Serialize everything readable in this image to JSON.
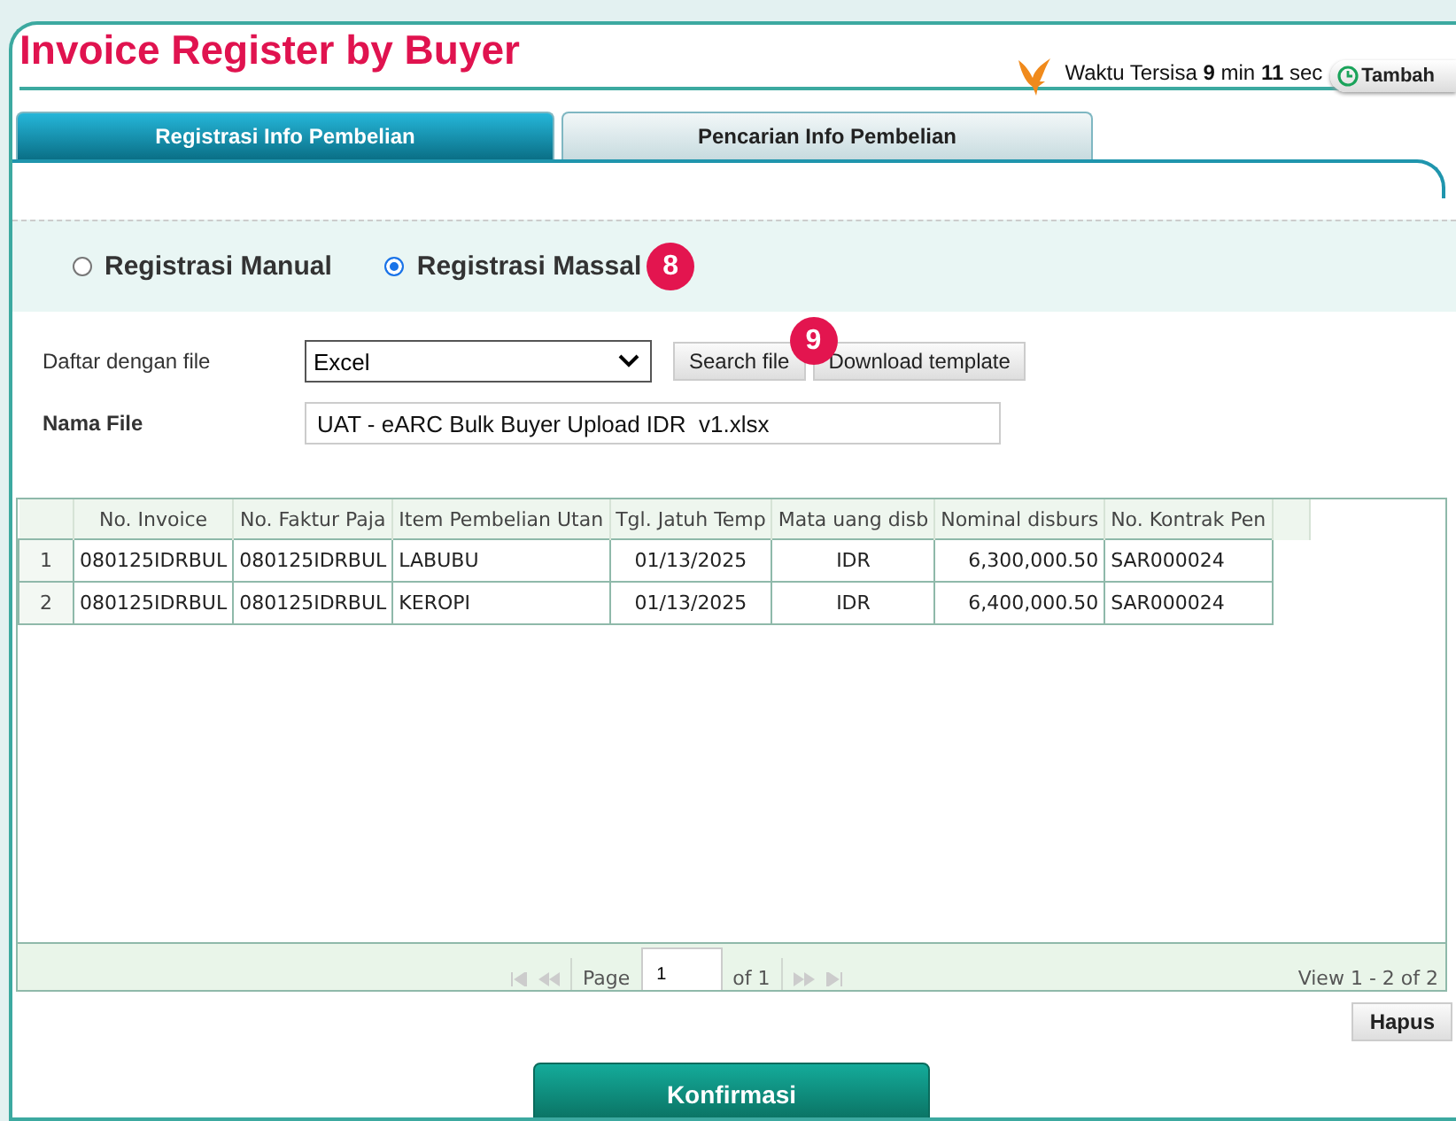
{
  "header": {
    "title": "Invoice Register by Buyer",
    "timer": {
      "label": "Waktu Tersisa",
      "minutes": "9",
      "min_label": "min",
      "seconds": "11",
      "sec_label": "sec",
      "button": "Tambah"
    }
  },
  "tabs": [
    {
      "label": "Registrasi Info Pembelian",
      "selected": true
    },
    {
      "label": "Pencarian Info Pembelian",
      "selected": false
    }
  ],
  "registration_mode": [
    {
      "label": "Registrasi Manual",
      "selected": false
    },
    {
      "label": "Registrasi Massal",
      "selected": true,
      "badge": "8"
    }
  ],
  "form": {
    "file_type": {
      "label": "Daftar dengan file",
      "value": "Excel"
    },
    "search_button": {
      "label": "Search file",
      "badge": "9"
    },
    "download_button": "Download template",
    "file_name": {
      "label": "Nama File",
      "value": "UAT - eARC Bulk Buyer Upload IDR  v1.xlsx"
    }
  },
  "grid": {
    "columns": [
      {
        "label": "No. Invoice",
        "kind": "text"
      },
      {
        "label": "No. Faktur Paja",
        "kind": "text"
      },
      {
        "label": "Item Pembelian Utan",
        "kind": "text"
      },
      {
        "label": "Tgl. Jatuh Temp",
        "kind": "date"
      },
      {
        "label": "Mata uang disb",
        "kind": "currency"
      },
      {
        "label": "Nominal disburs",
        "kind": "amount"
      },
      {
        "label": "No. Kontrak Pen",
        "kind": "text"
      }
    ],
    "rows": [
      {
        "number": "1",
        "cells": [
          "080125IDRBUL",
          "080125IDRBUL",
          "LABUBU",
          "01/13/2025",
          "IDR",
          "6,300,000.50",
          "SAR000024"
        ]
      },
      {
        "number": "2",
        "cells": [
          "080125IDRBUL",
          "080125IDRBUL",
          "KEROPI",
          "01/13/2025",
          "IDR",
          "6,400,000.50",
          "SAR000024"
        ]
      }
    ],
    "pager": {
      "page_label": "Page",
      "page": "1",
      "of": "of 1",
      "view": "View 1 - 2 of 2"
    }
  },
  "buttons": {
    "delete": "Hapus",
    "confirm": "Konfirmasi"
  }
}
